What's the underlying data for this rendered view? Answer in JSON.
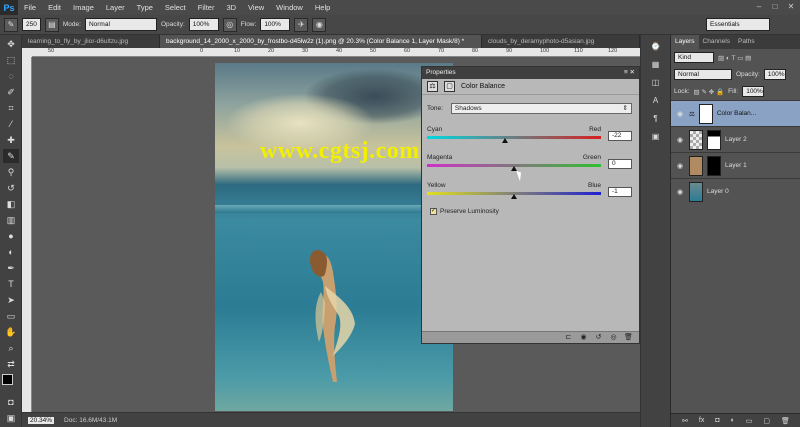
{
  "menubar": {
    "logo": "Ps",
    "items": [
      "File",
      "Edit",
      "Image",
      "Layer",
      "Type",
      "Select",
      "Filter",
      "3D",
      "View",
      "Window",
      "Help"
    ]
  },
  "options": {
    "brush_size": "250",
    "mode_label": "Mode:",
    "mode_value": "Normal",
    "opacity_label": "Opacity:",
    "opacity_value": "100%",
    "flow_label": "Flow:",
    "flow_value": "100%",
    "workspace": "Essentials"
  },
  "tabs": [
    {
      "label": "learning_to_fly_by_jlior-d6ultzu.jpg",
      "active": false
    },
    {
      "label": "background_14_2000_x_2000_by_frostbo-d45lw2z (1).png @ 20.3% (Color Balance 1, Layer Mask/8) *",
      "active": true
    },
    {
      "label": "clouds_by_deramyphoto-d5asian.jpg",
      "active": false
    }
  ],
  "ruler_ticks": [
    "50",
    "0",
    "10",
    "20",
    "30",
    "40",
    "50",
    "60",
    "70",
    "80",
    "90",
    "100",
    "110",
    "120"
  ],
  "watermark": "www.cgtsj.com",
  "status": {
    "zoom": "20.34%",
    "doc": "Doc: 16.6M/43.1M"
  },
  "properties": {
    "header": "Properties",
    "title": "Color Balance",
    "tone_label": "Tone:",
    "tone_value": "Shadows",
    "sliders": [
      {
        "left": "Cyan",
        "right": "Red",
        "value": "-22",
        "position": 0.45
      },
      {
        "left": "Magenta",
        "right": "Green",
        "value": "0",
        "position": 0.5
      },
      {
        "left": "Yellow",
        "right": "Blue",
        "value": "-1",
        "position": 0.5
      }
    ],
    "preserve_label": "Preserve Luminosity"
  },
  "layers_panel": {
    "tabs": [
      "Layers",
      "Channels",
      "Paths"
    ],
    "filter_value": "Kind",
    "blend_value": "Normal",
    "opacity_label": "Opacity:",
    "opacity_value": "100%",
    "lock_label": "Lock:",
    "fill_label": "Fill:",
    "fill_value": "100%",
    "layers": [
      {
        "name": "Color Balan...",
        "selected": true
      },
      {
        "name": "Layer 2",
        "selected": false
      },
      {
        "name": "Layer 1",
        "selected": false
      },
      {
        "name": "Layer 0",
        "selected": false
      }
    ]
  },
  "colors": {
    "accent": "#31a8ff",
    "watermark": "#f2f000",
    "selection": "#8aa3c4"
  }
}
